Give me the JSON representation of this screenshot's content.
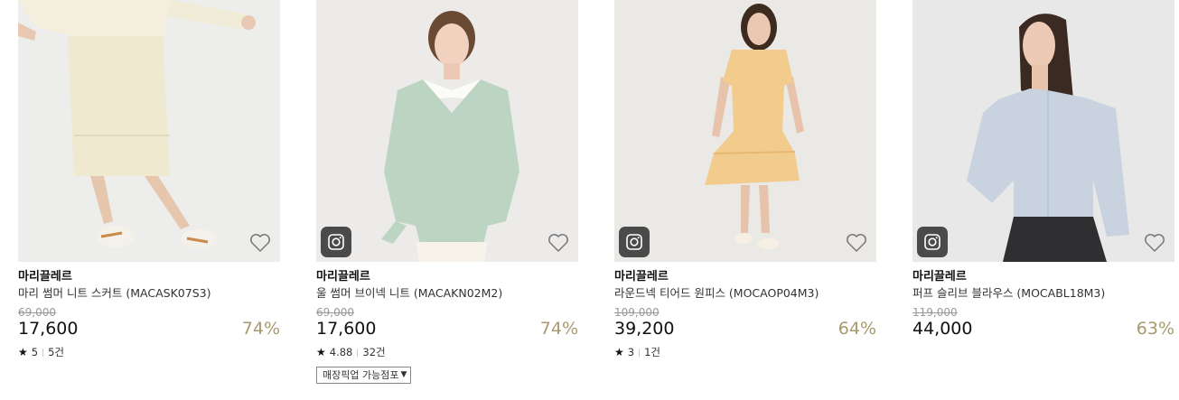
{
  "products": [
    {
      "brand": "마리끌레르",
      "name": "마리 썸머 니트 스커트 (MACASK07S3)",
      "original_price": "69,000",
      "price": "17,600",
      "discount": "74%",
      "rating": "5",
      "reviews": "5건",
      "has_instagram": false,
      "pickup_label": null
    },
    {
      "brand": "마리끌레르",
      "name": "울 썸머 브이넥 니트 (MACAKN02M2)",
      "original_price": "69,000",
      "price": "17,600",
      "discount": "74%",
      "rating": "4.88",
      "reviews": "32건",
      "has_instagram": true,
      "pickup_label": "매장픽업 가능점포"
    },
    {
      "brand": "마리끌레르",
      "name": "라운드넥 티어드 원피스 (MOCAOP04M3)",
      "original_price": "109,000",
      "price": "39,200",
      "discount": "64%",
      "rating": "3",
      "reviews": "1건",
      "has_instagram": true,
      "pickup_label": null
    },
    {
      "brand": "마리끌레르",
      "name": "퍼프 슬리브 블라우스 (MOCABL18M3)",
      "original_price": "119,000",
      "price": "44,000",
      "discount": "63%",
      "rating": null,
      "reviews": null,
      "has_instagram": true,
      "pickup_label": null
    }
  ],
  "icons": {
    "wishlist": "heart-outline-icon",
    "instagram": "instagram-icon",
    "rating": "star-icon",
    "dropdown": "caret-down-icon"
  },
  "colors": {
    "discount": "#a79a6f",
    "original_price": "#999999",
    "instagram_badge": "#4a4a4a"
  }
}
